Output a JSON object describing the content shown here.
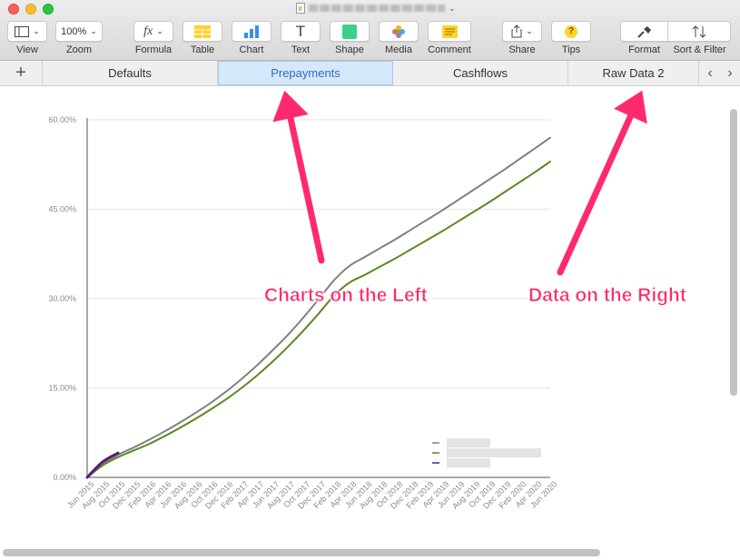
{
  "toolbar": {
    "view_label": "View",
    "zoom_value": "100%",
    "zoom_label": "Zoom",
    "formula_label": "Formula",
    "table_label": "Table",
    "chart_label": "Chart",
    "text_label": "Text",
    "shape_label": "Shape",
    "media_label": "Media",
    "comment_label": "Comment",
    "share_label": "Share",
    "tips_label": "Tips",
    "format_label": "Format",
    "sort_filter_label": "Sort & Filter",
    "formula_glyph": "fx",
    "text_glyph": "T",
    "tips_glyph": "?"
  },
  "tabs": {
    "add_glyph": "+",
    "items": [
      {
        "label": "Defaults",
        "active": false
      },
      {
        "label": "Prepayments",
        "active": true
      },
      {
        "label": "Cashflows",
        "active": false
      },
      {
        "label": "Raw Data 2",
        "active": false
      }
    ],
    "prev_glyph": "‹",
    "next_glyph": "›"
  },
  "annotations": {
    "left": "Charts on the Left",
    "right": "Data on the Right",
    "color": "#ff2a6d"
  },
  "chart_data": {
    "type": "line",
    "y_ticks": [
      "0.00%",
      "15.00%",
      "30.00%",
      "45.00%",
      "60.00%"
    ],
    "ylim": [
      0,
      60
    ],
    "x": [
      "Jun 2015",
      "Aug 2015",
      "Oct 2015",
      "Dec 2015",
      "Feb 2016",
      "Apr 2016",
      "Jun 2016",
      "Aug 2016",
      "Oct 2016",
      "Dec 2016",
      "Feb 2017",
      "Apr 2017",
      "Jun 2017",
      "Aug 2017",
      "Oct 2017",
      "Dec 2017",
      "Feb 2018",
      "Apr 2018",
      "Jun 2018",
      "Aug 2018",
      "Oct 2018",
      "Dec 2018",
      "Feb 2019",
      "Apr 2019",
      "Jun 2019",
      "Aug 2019",
      "Oct 2019",
      "Dec 2019",
      "Feb 2020",
      "Apr 2020",
      "Jun 2020"
    ],
    "grid": true,
    "legend": "bottom-right",
    "series": [
      {
        "color": "#808080",
        "values": [
          0.0,
          2.2,
          3.8,
          5.0,
          6.3,
          7.7,
          9.2,
          10.8,
          12.5,
          14.4,
          16.5,
          18.8,
          21.3,
          23.9,
          26.8,
          29.9,
          33.1,
          35.5,
          37.0,
          38.5,
          40.0,
          41.6,
          43.2,
          44.8,
          46.5,
          48.2,
          49.9,
          51.6,
          53.4,
          55.2,
          57.0
        ]
      },
      {
        "color": "#5a8a1e",
        "values": [
          0.0,
          2.0,
          3.4,
          4.5,
          5.6,
          6.9,
          8.3,
          9.8,
          11.4,
          13.1,
          15.0,
          17.1,
          19.4,
          21.9,
          24.6,
          27.5,
          30.5,
          32.7,
          34.0,
          35.4,
          36.8,
          38.3,
          39.8,
          41.3,
          42.9,
          44.5,
          46.1,
          47.8,
          49.5,
          51.2,
          53.0
        ]
      },
      {
        "color": "#5b1a7a",
        "values": [
          0.0,
          2.6,
          4.1
        ]
      }
    ]
  }
}
